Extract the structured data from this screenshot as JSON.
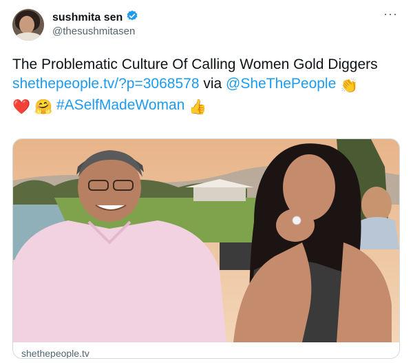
{
  "header": {
    "display_name": "sushmita sen",
    "handle": "@thesushmitasen",
    "verified_icon": "verified-badge-icon",
    "more_icon": "more-options-icon",
    "more_label": "···"
  },
  "tweet": {
    "title_line": "The Problematic Culture Of Calling Women Gold Diggers",
    "link_text": "shethepeople.tv/?p=3068578",
    "via_text": " via ",
    "mention": "@SheThePeople",
    "hashtag": "#ASelfMadeWoman",
    "emojis": {
      "clap": "👏",
      "heart": "❤️",
      "hug": "🤗",
      "thumbs_up": "👍"
    }
  },
  "card": {
    "image_icon": "photo-couple-image",
    "domain": "shethepeople.tv"
  },
  "colors": {
    "accent": "#1d9bf0",
    "text": "#0f1419",
    "secondary": "#536471",
    "border": "#cfd9de"
  }
}
